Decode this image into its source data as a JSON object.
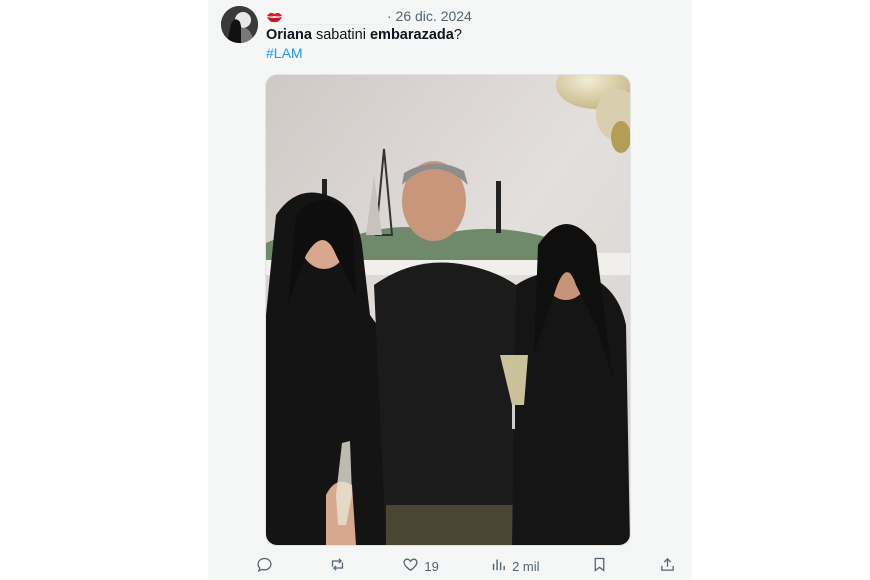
{
  "post": {
    "date": "· 26 dic. 2024",
    "text_part1": "Oriana",
    "text_part2": " sabatini ",
    "text_part3": "embarazada",
    "text_part4": "?",
    "hashtag": "#LAM",
    "author_badge_icon": "lips-icon"
  },
  "actions": {
    "reply_count": "",
    "repost_count": "",
    "like_count": "19",
    "views_count": "2 mil"
  },
  "colors": {
    "link": "#1d9bf0",
    "muted": "#536471",
    "text": "#0f1419",
    "card_bg": "#f5f6f6"
  }
}
